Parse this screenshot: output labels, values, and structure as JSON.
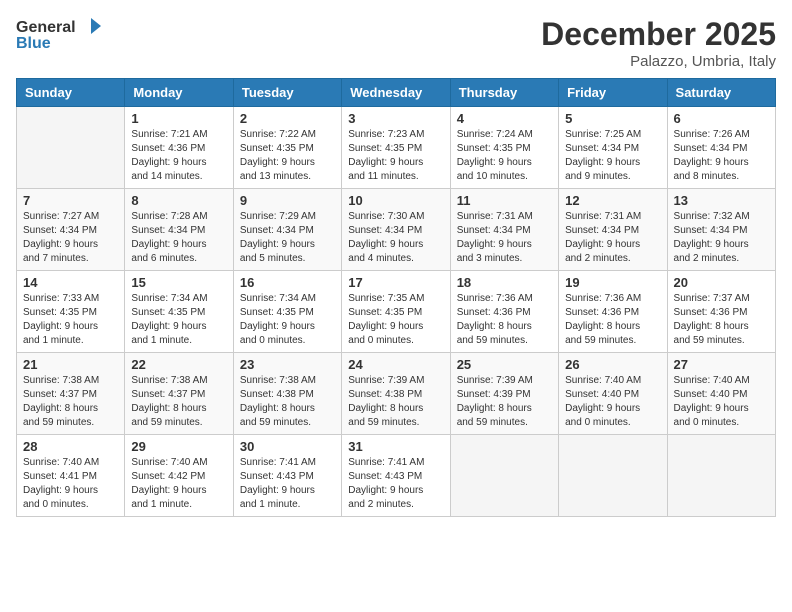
{
  "logo": {
    "general": "General",
    "blue": "Blue"
  },
  "title": "December 2025",
  "location": "Palazzo, Umbria, Italy",
  "days_header": [
    "Sunday",
    "Monday",
    "Tuesday",
    "Wednesday",
    "Thursday",
    "Friday",
    "Saturday"
  ],
  "weeks": [
    [
      {
        "num": "",
        "info": ""
      },
      {
        "num": "1",
        "info": "Sunrise: 7:21 AM\nSunset: 4:36 PM\nDaylight: 9 hours\nand 14 minutes."
      },
      {
        "num": "2",
        "info": "Sunrise: 7:22 AM\nSunset: 4:35 PM\nDaylight: 9 hours\nand 13 minutes."
      },
      {
        "num": "3",
        "info": "Sunrise: 7:23 AM\nSunset: 4:35 PM\nDaylight: 9 hours\nand 11 minutes."
      },
      {
        "num": "4",
        "info": "Sunrise: 7:24 AM\nSunset: 4:35 PM\nDaylight: 9 hours\nand 10 minutes."
      },
      {
        "num": "5",
        "info": "Sunrise: 7:25 AM\nSunset: 4:34 PM\nDaylight: 9 hours\nand 9 minutes."
      },
      {
        "num": "6",
        "info": "Sunrise: 7:26 AM\nSunset: 4:34 PM\nDaylight: 9 hours\nand 8 minutes."
      }
    ],
    [
      {
        "num": "7",
        "info": "Sunrise: 7:27 AM\nSunset: 4:34 PM\nDaylight: 9 hours\nand 7 minutes."
      },
      {
        "num": "8",
        "info": "Sunrise: 7:28 AM\nSunset: 4:34 PM\nDaylight: 9 hours\nand 6 minutes."
      },
      {
        "num": "9",
        "info": "Sunrise: 7:29 AM\nSunset: 4:34 PM\nDaylight: 9 hours\nand 5 minutes."
      },
      {
        "num": "10",
        "info": "Sunrise: 7:30 AM\nSunset: 4:34 PM\nDaylight: 9 hours\nand 4 minutes."
      },
      {
        "num": "11",
        "info": "Sunrise: 7:31 AM\nSunset: 4:34 PM\nDaylight: 9 hours\nand 3 minutes."
      },
      {
        "num": "12",
        "info": "Sunrise: 7:31 AM\nSunset: 4:34 PM\nDaylight: 9 hours\nand 2 minutes."
      },
      {
        "num": "13",
        "info": "Sunrise: 7:32 AM\nSunset: 4:34 PM\nDaylight: 9 hours\nand 2 minutes."
      }
    ],
    [
      {
        "num": "14",
        "info": "Sunrise: 7:33 AM\nSunset: 4:35 PM\nDaylight: 9 hours\nand 1 minute."
      },
      {
        "num": "15",
        "info": "Sunrise: 7:34 AM\nSunset: 4:35 PM\nDaylight: 9 hours\nand 1 minute."
      },
      {
        "num": "16",
        "info": "Sunrise: 7:34 AM\nSunset: 4:35 PM\nDaylight: 9 hours\nand 0 minutes."
      },
      {
        "num": "17",
        "info": "Sunrise: 7:35 AM\nSunset: 4:35 PM\nDaylight: 9 hours\nand 0 minutes."
      },
      {
        "num": "18",
        "info": "Sunrise: 7:36 AM\nSunset: 4:36 PM\nDaylight: 8 hours\nand 59 minutes."
      },
      {
        "num": "19",
        "info": "Sunrise: 7:36 AM\nSunset: 4:36 PM\nDaylight: 8 hours\nand 59 minutes."
      },
      {
        "num": "20",
        "info": "Sunrise: 7:37 AM\nSunset: 4:36 PM\nDaylight: 8 hours\nand 59 minutes."
      }
    ],
    [
      {
        "num": "21",
        "info": "Sunrise: 7:38 AM\nSunset: 4:37 PM\nDaylight: 8 hours\nand 59 minutes."
      },
      {
        "num": "22",
        "info": "Sunrise: 7:38 AM\nSunset: 4:37 PM\nDaylight: 8 hours\nand 59 minutes."
      },
      {
        "num": "23",
        "info": "Sunrise: 7:38 AM\nSunset: 4:38 PM\nDaylight: 8 hours\nand 59 minutes."
      },
      {
        "num": "24",
        "info": "Sunrise: 7:39 AM\nSunset: 4:38 PM\nDaylight: 8 hours\nand 59 minutes."
      },
      {
        "num": "25",
        "info": "Sunrise: 7:39 AM\nSunset: 4:39 PM\nDaylight: 8 hours\nand 59 minutes."
      },
      {
        "num": "26",
        "info": "Sunrise: 7:40 AM\nSunset: 4:40 PM\nDaylight: 9 hours\nand 0 minutes."
      },
      {
        "num": "27",
        "info": "Sunrise: 7:40 AM\nSunset: 4:40 PM\nDaylight: 9 hours\nand 0 minutes."
      }
    ],
    [
      {
        "num": "28",
        "info": "Sunrise: 7:40 AM\nSunset: 4:41 PM\nDaylight: 9 hours\nand 0 minutes."
      },
      {
        "num": "29",
        "info": "Sunrise: 7:40 AM\nSunset: 4:42 PM\nDaylight: 9 hours\nand 1 minute."
      },
      {
        "num": "30",
        "info": "Sunrise: 7:41 AM\nSunset: 4:43 PM\nDaylight: 9 hours\nand 1 minute."
      },
      {
        "num": "31",
        "info": "Sunrise: 7:41 AM\nSunset: 4:43 PM\nDaylight: 9 hours\nand 2 minutes."
      },
      {
        "num": "",
        "info": ""
      },
      {
        "num": "",
        "info": ""
      },
      {
        "num": "",
        "info": ""
      }
    ]
  ]
}
